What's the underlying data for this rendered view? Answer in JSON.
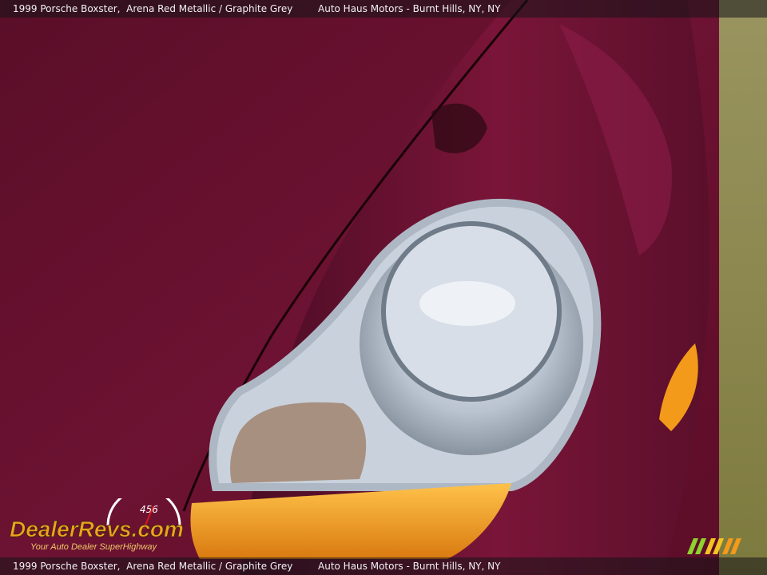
{
  "caption": {
    "vehicle": "1999 Porsche Boxster,",
    "color": "Arena Red Metallic / Graphite Grey",
    "dealer": "Auto Haus Motors - Burnt Hills, NY, NY"
  },
  "logo": {
    "brand": "DealerRevs.com",
    "tagline": "Your Auto Dealer SuperHighway",
    "gauge_digits": "456"
  },
  "colors": {
    "paint": "#6b1030",
    "accent_orange": "#f39a1a",
    "grass": "#8f8a4f"
  },
  "icons": [
    "speedometer-icon",
    "stripes-badge-icon"
  ]
}
